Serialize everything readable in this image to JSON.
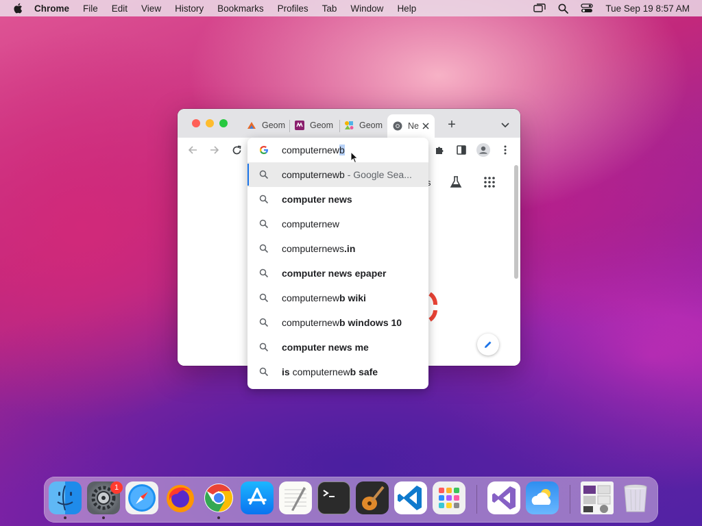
{
  "menubar": {
    "app_name": "Chrome",
    "items": [
      "File",
      "Edit",
      "View",
      "History",
      "Bookmarks",
      "Profiles",
      "Tab",
      "Window",
      "Help"
    ],
    "clock": "Tue Sep 19  8:57 AM",
    "status_icons": [
      "screen-mirroring-icon",
      "spotlight-search-icon",
      "control-center-icon"
    ]
  },
  "browser": {
    "tabs": [
      {
        "label": "Geom",
        "icon": "geogebra-icon"
      },
      {
        "label": "Geom",
        "icon": "geometry-app-icon"
      },
      {
        "label": "Geom",
        "icon": "geometry-shapes-icon"
      },
      {
        "label": "Ne",
        "icon": "chrome-icon",
        "active": true
      }
    ],
    "new_tab_label": "+",
    "partial_page_text": "s",
    "omnibox": {
      "typed": "computernew",
      "autocomplete": "b",
      "suggestions": [
        {
          "pre": "computernewb",
          "bold": "",
          "desc": " - Google Sea...",
          "highlighted": true
        },
        {
          "pre": "",
          "bold": "computer news",
          "desc": ""
        },
        {
          "pre": "computernew",
          "bold": "",
          "desc": ""
        },
        {
          "pre": "computernews",
          "bold": ".in",
          "desc": ""
        },
        {
          "pre": "",
          "bold": "computer news epaper",
          "desc": ""
        },
        {
          "pre": "computernew",
          "bold": "b wiki",
          "desc": ""
        },
        {
          "pre": "computernew",
          "bold": "b windows 10",
          "desc": ""
        },
        {
          "pre": "",
          "bold": "computer news me",
          "desc": ""
        },
        {
          "boldpre": "is ",
          "pre": "computernew",
          "bold": "b safe",
          "desc": ""
        }
      ]
    }
  },
  "dock": {
    "apps": [
      "Finder",
      "System Settings",
      "Safari",
      "Firefox",
      "Chrome",
      "App Store",
      "TextEdit",
      "Terminal",
      "GarageBand",
      "Visual Studio Code",
      "Launchpad",
      "Visual Studio",
      "Weather",
      "Downloads",
      "Trash"
    ],
    "settings_badge": "1"
  },
  "colors": {
    "accent": "#1a73e8",
    "traffic_red": "#fe5f57",
    "traffic_yellow": "#febc2e",
    "traffic_green": "#28c840"
  }
}
